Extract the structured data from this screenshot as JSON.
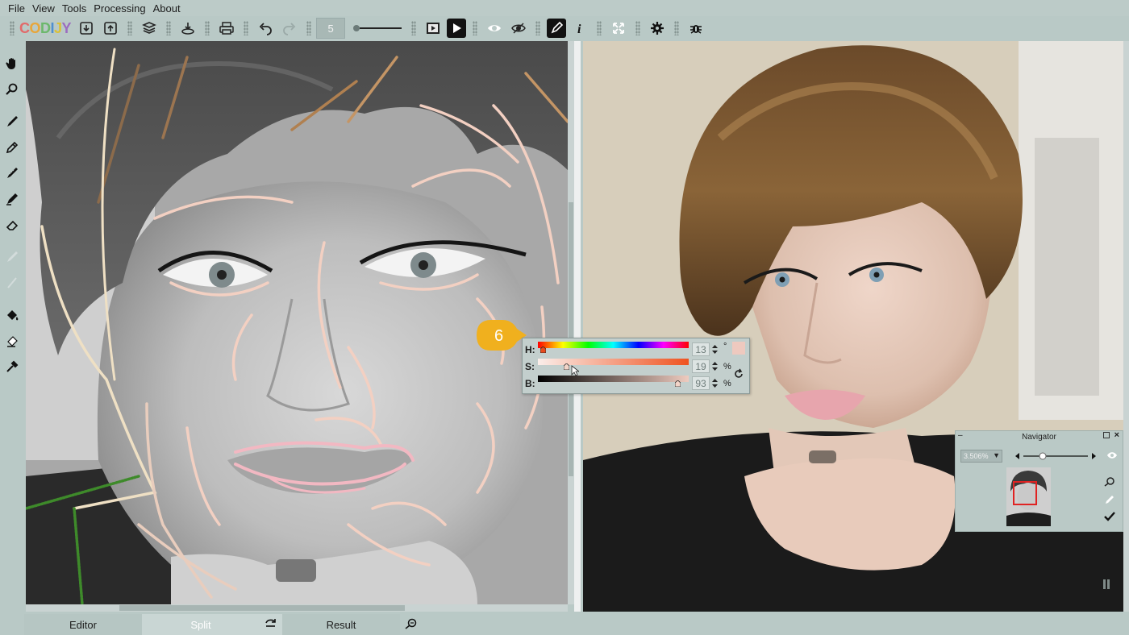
{
  "menu": [
    "File",
    "View",
    "Tools",
    "Processing",
    "About"
  ],
  "toolbar": {
    "logo_text": "CODIJY",
    "brush_size": "5",
    "icons": [
      "import-icon",
      "export-icon",
      "library-icon",
      "save-icon",
      "print-icon",
      "undo-icon",
      "redo-icon",
      "preview-icon",
      "play-icon",
      "eye-icon",
      "hide-strokes-icon",
      "pen-mode-icon",
      "info-icon",
      "fit-icon",
      "settings-icon",
      "bug-icon"
    ]
  },
  "tools": [
    "hand-icon",
    "zoom-icon",
    "brush-icon",
    "pencil-icon",
    "dotted-brush-icon",
    "marker-icon",
    "eraser-icon",
    "disabled-brush-icon",
    "disabled-pen-icon",
    "fill-icon",
    "fill-eraser-icon",
    "eyedropper-icon"
  ],
  "color_picker": {
    "h_label": "H:",
    "s_label": "S:",
    "b_label": "B:",
    "h_value": "13",
    "s_value": "19",
    "b_value": "93",
    "h_unit": "°",
    "s_unit": "%",
    "b_unit": "%",
    "h_fraction": 0.036,
    "s_fraction": 0.19,
    "b_fraction": 0.93,
    "swatch_color": "#eec9bf"
  },
  "callout": {
    "number": "6",
    "color": "#f0b01e"
  },
  "navigator": {
    "title": "Navigator",
    "zoom": "3.506%",
    "zoom_fraction": 0.3
  },
  "tabs": {
    "editor": "Editor",
    "split": "Split",
    "result": "Result"
  }
}
